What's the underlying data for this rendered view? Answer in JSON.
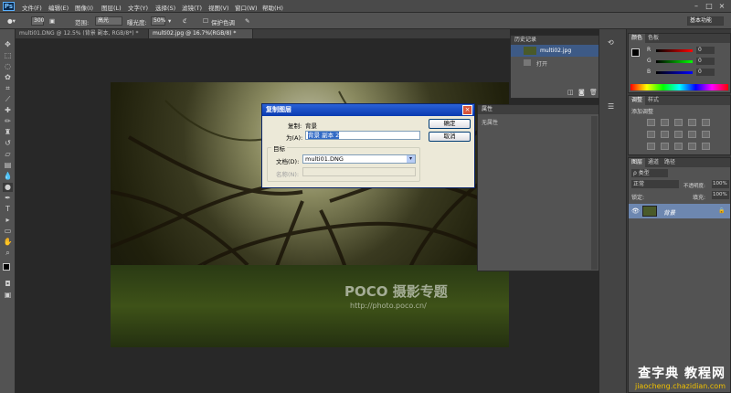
{
  "app": {
    "logo": "Ps"
  },
  "menu": [
    "文件(F)",
    "编辑(E)",
    "图像(I)",
    "图层(L)",
    "文字(Y)",
    "选择(S)",
    "滤镜(T)",
    "视图(V)",
    "窗口(W)",
    "帮助(H)"
  ],
  "options": {
    "brush_size": "300",
    "range_label": "范围:",
    "range_value": "高光",
    "exposure_label": "曝光度:",
    "exposure_value": "50%",
    "protect_tones": "保护色调",
    "workspace": "基本功能"
  },
  "tabs": [
    {
      "label": "multi01.DNG @ 12.5% (背景 副本, RGB/8*) *"
    },
    {
      "label": "multi02.jpg @ 16.7%(RGB/8) *"
    }
  ],
  "history": {
    "title": "历史记录",
    "items": [
      {
        "label": "multi02.jpg"
      },
      {
        "label": "打开"
      }
    ]
  },
  "properties": {
    "title": "属性",
    "empty": "无属性"
  },
  "dialog": {
    "title": "复制图层",
    "copy_label": "复制:",
    "copy_value": "背景",
    "as_label": "为(A):",
    "as_value": "背景 副本 2",
    "ok": "确定",
    "cancel": "取消",
    "dest_legend": "目标",
    "doc_label": "文档(D):",
    "doc_value": "multi01.DNG",
    "name_label": "名称(N):",
    "name_value": ""
  },
  "color_panel": {
    "tabs": [
      "颜色",
      "色板"
    ],
    "channels": [
      {
        "label": "R",
        "value": "0",
        "color": "#ff0000"
      },
      {
        "label": "G",
        "value": "0",
        "color": "#00ff00"
      },
      {
        "label": "B",
        "value": "0",
        "color": "#0000ff"
      }
    ]
  },
  "adjust_panel": {
    "tabs": [
      "调整",
      "样式"
    ],
    "add_label": "添加调整"
  },
  "layers_panel": {
    "tabs": [
      "图层",
      "通道",
      "路径"
    ],
    "kind_label": "ρ 类型",
    "blend": "正常",
    "opacity_label": "不透明度:",
    "opacity": "100%",
    "lock_label": "锁定:",
    "fill_label": "填充:",
    "fill": "100%",
    "layer_name": "背景"
  },
  "photo_watermark": {
    "brand": "POCO 摄影专题",
    "url": "http://photo.poco.cn/"
  },
  "site_watermark": {
    "title": "查字典 教程网",
    "url": "jiaocheng.chazidian.com"
  },
  "colors": {
    "selection": "#6d87b0",
    "dialog_title": "#0a3ab0",
    "panel": "#535353"
  }
}
